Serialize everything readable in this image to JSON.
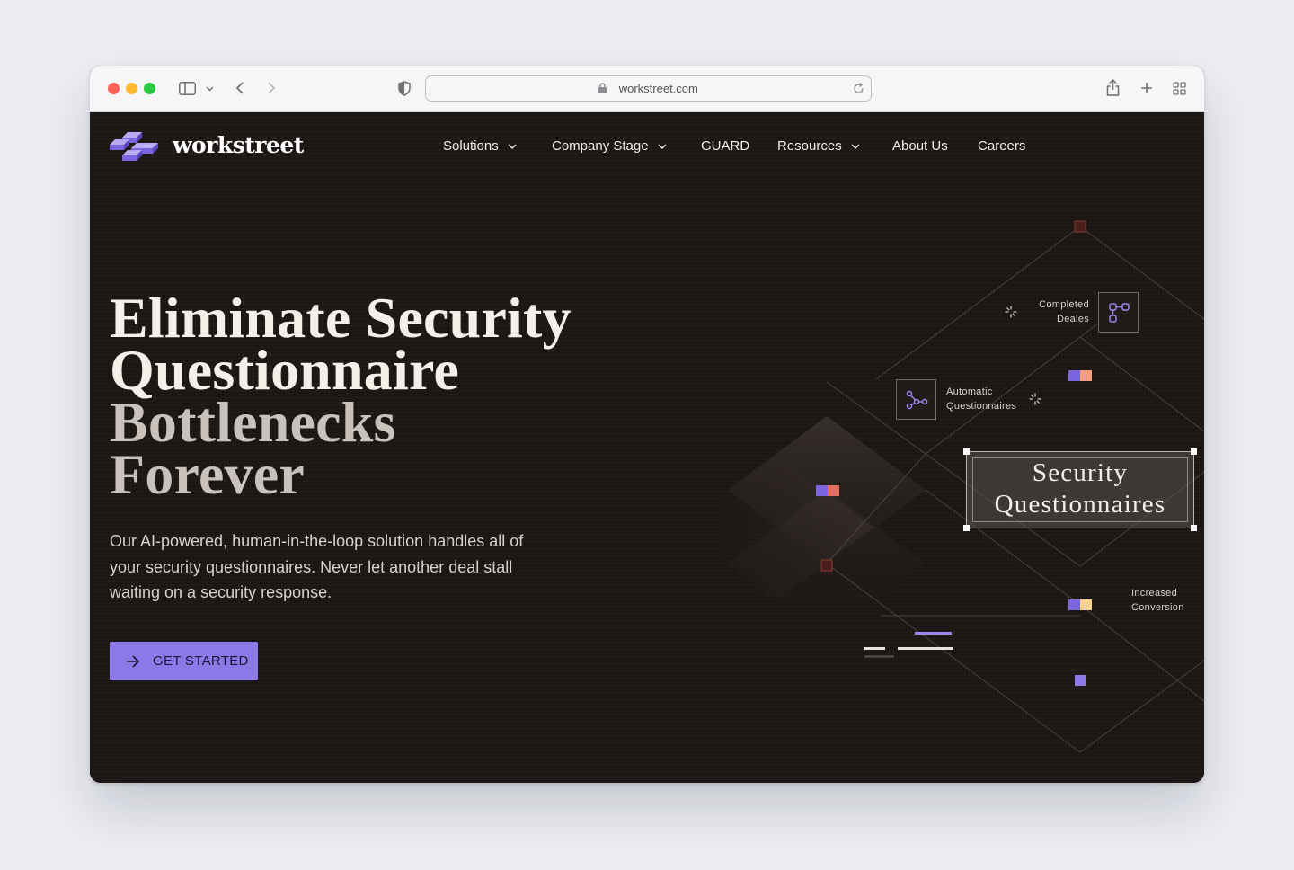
{
  "browser": {
    "url": "workstreet.com"
  },
  "site": {
    "brand": "workstreet",
    "nav": [
      {
        "label": "Solutions",
        "has_dropdown": true
      },
      {
        "label": "Company Stage",
        "has_dropdown": true
      },
      {
        "label": "GUARD",
        "has_dropdown": false
      },
      {
        "label": "Resources",
        "has_dropdown": true
      },
      {
        "label": "About Us",
        "has_dropdown": false
      },
      {
        "label": "Careers",
        "has_dropdown": false
      }
    ]
  },
  "hero": {
    "title_line1": "Eliminate Security",
    "title_line2": "Questionnaire",
    "title_line3": "Bottlenecks",
    "title_line4": "Forever",
    "subtitle": "Our AI-powered, human-in-the-loop solution handles all of your security questionnaires. Never let another deal stall waiting on a security response.",
    "cta_label": "GET STARTED"
  },
  "diagram": {
    "label_completed": "Completed Deales",
    "label_automatic": "Automatic Questionnaires",
    "label_center": "Security Questionnaires",
    "label_increased": "Increased Conversion"
  },
  "colors": {
    "accent": "#8c79e8",
    "background": "#1c1614",
    "coral": "#e2705c",
    "peach": "#f2a07e",
    "yellow": "#f5d38a",
    "maroon": "#6a2a22"
  }
}
